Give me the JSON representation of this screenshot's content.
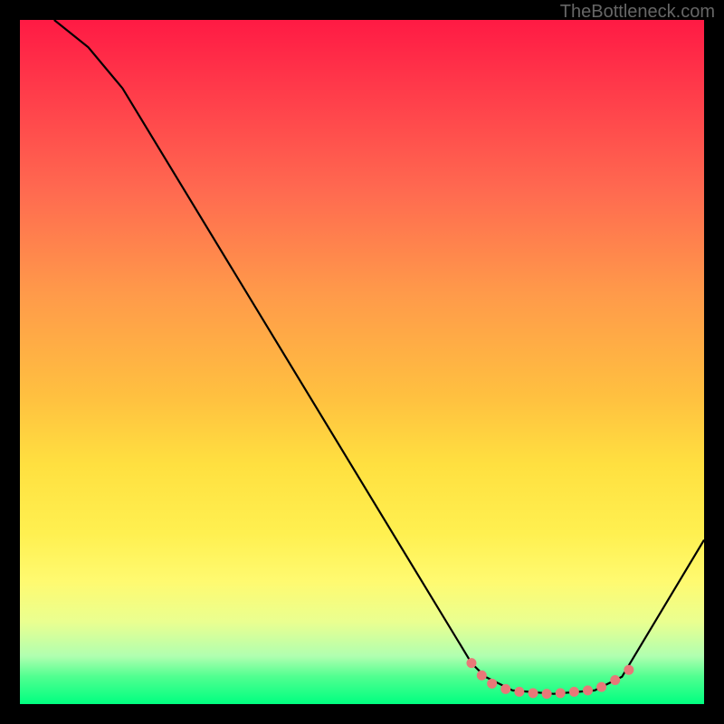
{
  "attribution": "TheBottleneck.com",
  "chart_data": {
    "type": "line",
    "title": "",
    "xlabel": "",
    "ylabel": "",
    "xlim": [
      0,
      100
    ],
    "ylim": [
      0,
      100
    ],
    "curve": {
      "name": "bottleneck-curve",
      "points": [
        {
          "x": 5,
          "y": 100
        },
        {
          "x": 10,
          "y": 96
        },
        {
          "x": 15,
          "y": 90
        },
        {
          "x": 66,
          "y": 6
        },
        {
          "x": 68,
          "y": 4
        },
        {
          "x": 72,
          "y": 2
        },
        {
          "x": 78,
          "y": 1.5
        },
        {
          "x": 84,
          "y": 2
        },
        {
          "x": 88,
          "y": 4
        },
        {
          "x": 100,
          "y": 24
        }
      ]
    },
    "highlight_points": [
      {
        "x": 66,
        "y": 6
      },
      {
        "x": 67.5,
        "y": 4.2
      },
      {
        "x": 69,
        "y": 3
      },
      {
        "x": 71,
        "y": 2.2
      },
      {
        "x": 73,
        "y": 1.8
      },
      {
        "x": 75,
        "y": 1.6
      },
      {
        "x": 77,
        "y": 1.5
      },
      {
        "x": 79,
        "y": 1.6
      },
      {
        "x": 81,
        "y": 1.8
      },
      {
        "x": 83,
        "y": 2
      },
      {
        "x": 85,
        "y": 2.5
      },
      {
        "x": 87,
        "y": 3.5
      },
      {
        "x": 89,
        "y": 5
      }
    ],
    "colors": {
      "curve": "#000000",
      "highlight": "#e87878"
    }
  }
}
